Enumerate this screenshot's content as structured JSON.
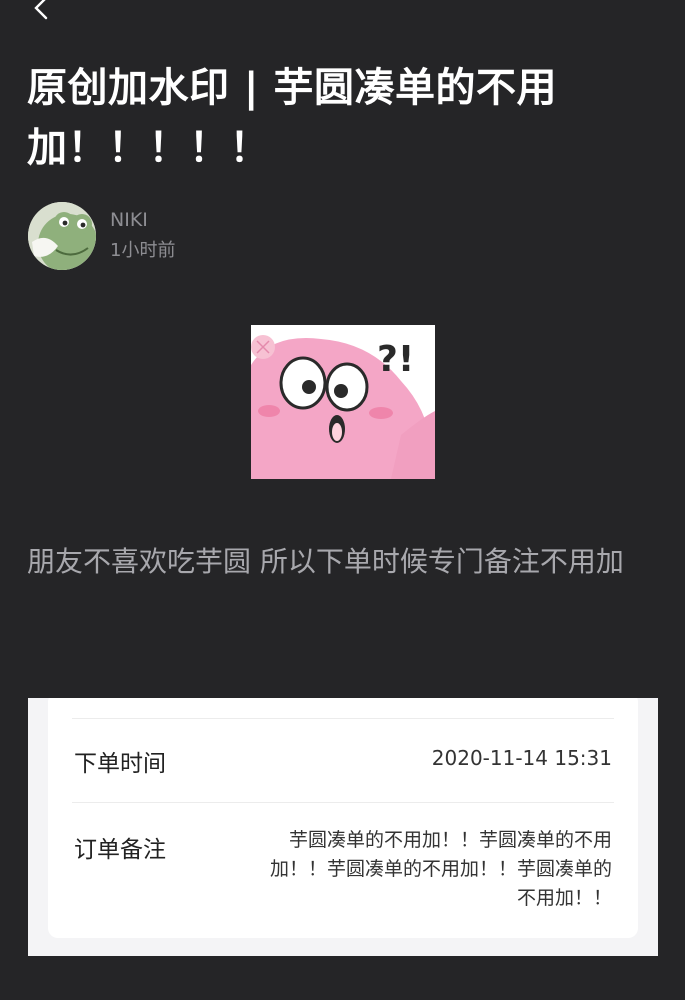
{
  "post": {
    "title": "原创加水印 | 芋圆凑单的不用加！！！！！",
    "author": {
      "name": "NIKI",
      "time": "1小时前"
    },
    "sticker": {
      "caption": "?!"
    },
    "body": "朋友不喜欢吃芋圆 所以下单时候专门备注不用加"
  },
  "order": {
    "order_time_label": "下单时间",
    "order_time_value": "2020-11-14 15:31",
    "note_label": "订单备注",
    "note_value": "芋圆凑单的不用加！！芋圆凑单的不用加！！芋圆凑单的不用加！！芋圆凑单的不用加！！"
  },
  "icons": {
    "back": "chevron-left-icon",
    "avatar": "frog-avatar",
    "sticker": "pink-cartoon-surprised-sticker"
  },
  "colors": {
    "background": "#252527",
    "title": "#ffffff",
    "meta": "#8e8e93",
    "body_text": "#a8a8ad",
    "sticker_pink": "#f4a6c6"
  }
}
